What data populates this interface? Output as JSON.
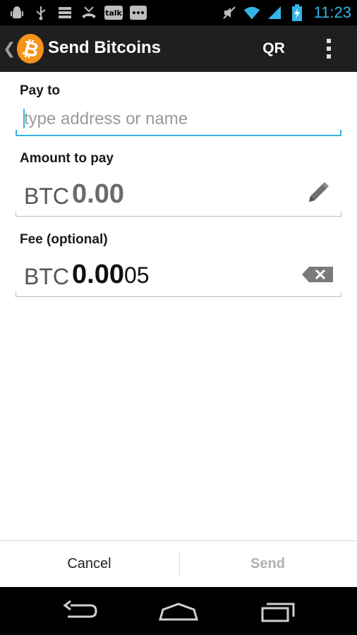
{
  "status_bar": {
    "time": "11:23",
    "left_icons": [
      "android-debug-icon",
      "usb-icon",
      "storage-icon",
      "missed-call-icon",
      "talk-icon",
      "chat-icon"
    ],
    "talk_label": "talk",
    "right_icons": [
      "mute-icon",
      "wifi-icon",
      "signal-icon",
      "battery-charging-icon"
    ]
  },
  "action_bar": {
    "title": "Send Bitcoins",
    "logo_glyph": "₿",
    "qr_label": "QR"
  },
  "form": {
    "pay_to_label": "Pay to",
    "address_placeholder": "type address or name",
    "address_value": "",
    "amount_label": "Amount to pay",
    "amount_currency": "BTC",
    "amount_value": "0.00",
    "fee_label": "Fee (optional)",
    "fee_currency": "BTC",
    "fee_value_main": "0.00",
    "fee_value_extra": "05"
  },
  "buttons": {
    "cancel": "Cancel",
    "send": "Send",
    "send_enabled": false
  },
  "colors": {
    "accent": "#33b5e5",
    "bitcoin_orange": "#f7931a",
    "action_bar": "#1f1f1f"
  }
}
